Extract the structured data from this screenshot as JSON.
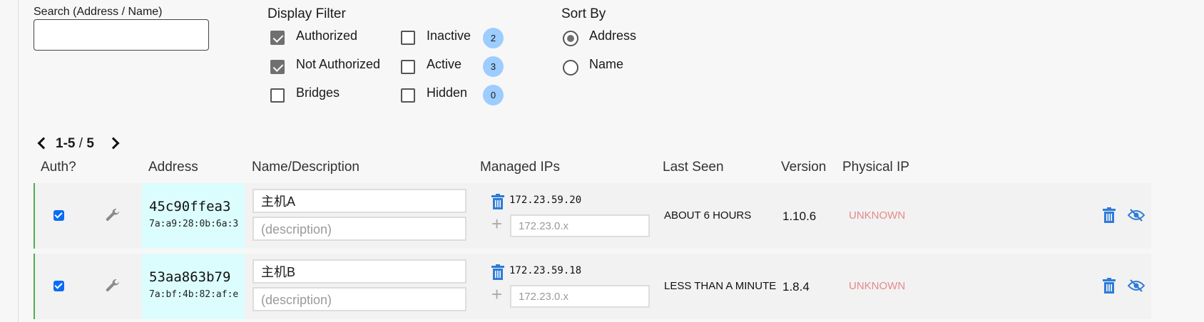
{
  "search": {
    "label": "Search (Address / Name)",
    "value": ""
  },
  "display_filter": {
    "title": "Display Filter",
    "options": [
      {
        "label": "Authorized",
        "checked": true
      },
      {
        "label": "Not Authorized",
        "checked": true
      },
      {
        "label": "Bridges",
        "checked": false
      },
      {
        "label": "Inactive",
        "checked": false,
        "count": "2"
      },
      {
        "label": "Active",
        "checked": false,
        "count": "3"
      },
      {
        "label": "Hidden",
        "checked": false,
        "count": "0"
      }
    ]
  },
  "sort_by": {
    "title": "Sort By",
    "options": [
      {
        "label": "Address",
        "selected": true
      },
      {
        "label": "Name",
        "selected": false
      }
    ]
  },
  "pagination": {
    "range": "1-5",
    "separator": "/",
    "total": "5"
  },
  "table": {
    "headers": [
      "Auth?",
      "Address",
      "Name/Description",
      "Managed IPs",
      "Last Seen",
      "Version",
      "Physical IP"
    ],
    "rows": [
      {
        "authorized": true,
        "address": "45c90ffea3",
        "mac": "7a:a9:28:0b:6a:3",
        "name": "主机A",
        "description_placeholder": "(description)",
        "managed_ip": "172.23.59.20",
        "ip_placeholder": "172.23.0.x",
        "last_seen": "ABOUT 6 HOURS",
        "version": "1.10.6",
        "physical_ip": "UNKNOWN"
      },
      {
        "authorized": true,
        "address": "53aa863b79",
        "mac": "7a:bf:4b:82:af:e",
        "name": "主机B",
        "description_placeholder": "(description)",
        "managed_ip": "172.23.59.18",
        "ip_placeholder": "172.23.0.x",
        "last_seen": "LESS THAN A MINUTE",
        "version": "1.8.4",
        "physical_ip": "UNKNOWN"
      }
    ]
  },
  "icons": {
    "wrench": "wrench-icon",
    "trash": "trash-icon",
    "hide": "eye-slash-icon",
    "prev": "chevron-left-icon",
    "next": "chevron-right-icon",
    "plus": "plus-icon"
  },
  "colors": {
    "accent": "#2e7cd6",
    "badge": "#9dccff",
    "address_bg": "#dcfdfe",
    "row_border": "#4caf50",
    "unknown": "#e58a8a"
  }
}
